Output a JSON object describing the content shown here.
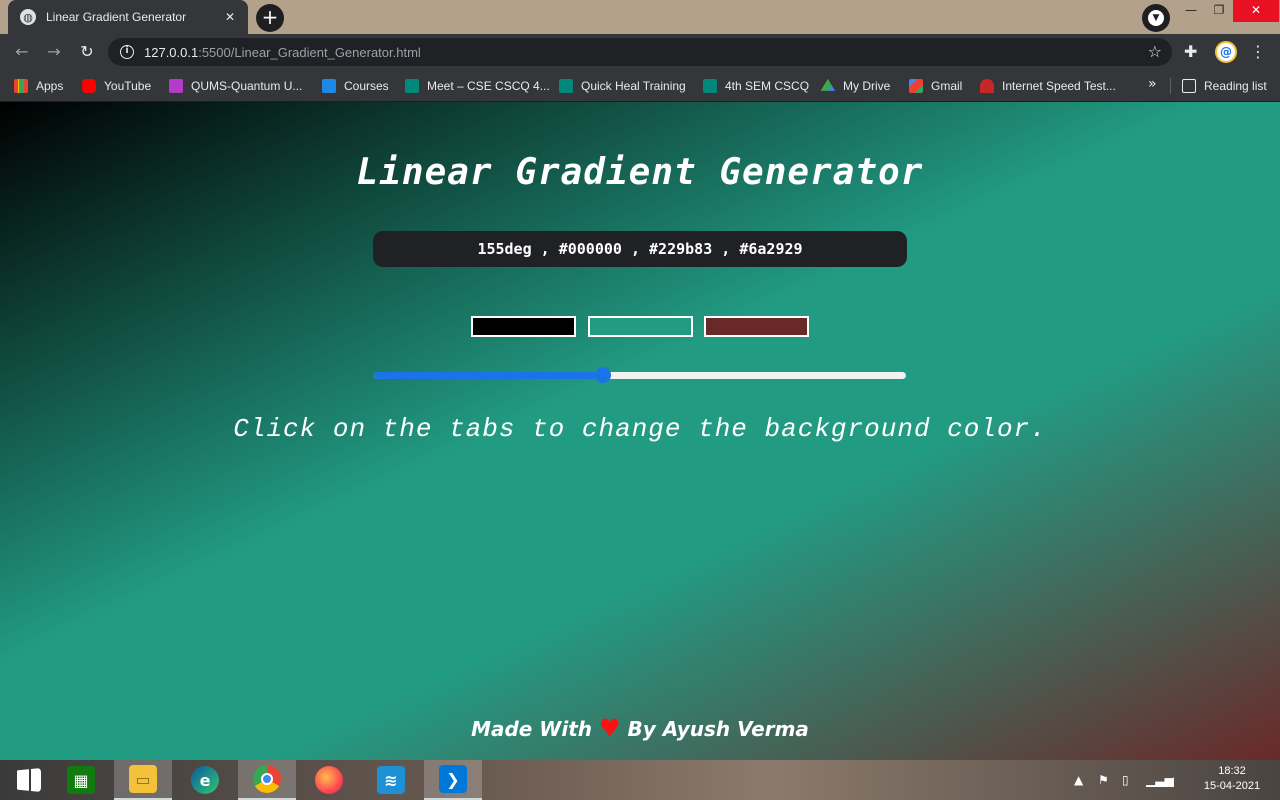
{
  "browser": {
    "tab_title": "Linear Gradient Generator",
    "url_host": "127.0.0.1",
    "url_rest": ":5500/Linear_Gradient_Generator.html",
    "bookmarks": [
      "Apps",
      "YouTube",
      "QUMS-Quantum U...",
      "Courses",
      "Meet – CSE CSCQ 4...",
      "Quick Heal Training",
      "4th SEM CSCQ",
      "My Drive",
      "Gmail",
      "Internet Speed Test..."
    ],
    "reading_list": "Reading list",
    "avatar_letter": "@"
  },
  "app": {
    "title": "Linear Gradient Generator",
    "css_output": "155deg , #000000 , #229b83 , #6a2929",
    "colors": [
      "#000000",
      "#229b83",
      "#6a2929"
    ],
    "slider_fraction": 0.43,
    "instruction": "Click on the tabs to change the background color.",
    "footer_before": "Made With",
    "footer_heart": "♥",
    "footer_after": "By Ayush Verma"
  },
  "taskbar": {
    "time": "18:32",
    "date": "15-04-2021"
  }
}
